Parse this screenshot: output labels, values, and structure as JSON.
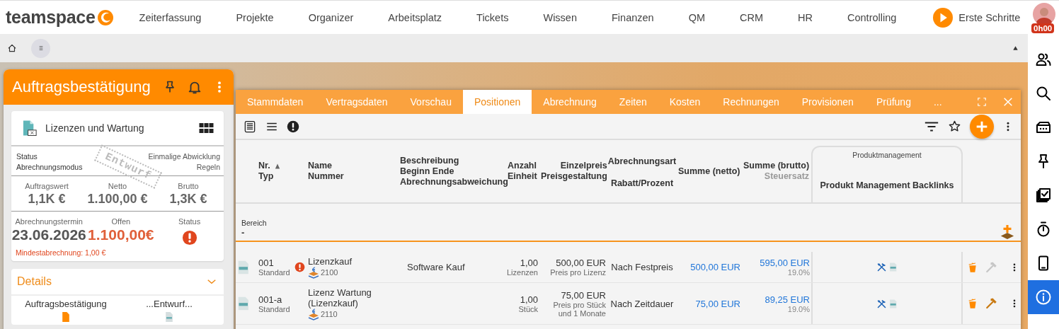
{
  "top_nav": {
    "logo": "teamspace",
    "items": [
      {
        "label": "Zeiterfassung"
      },
      {
        "label": "Projekte"
      },
      {
        "label": "Organizer"
      },
      {
        "label": "Arbeitsplatz"
      },
      {
        "label": "Tickets"
      },
      {
        "label": "Wissen"
      },
      {
        "label": "Finanzen"
      },
      {
        "label": "QM"
      },
      {
        "label": "CRM"
      },
      {
        "label": "HR"
      },
      {
        "label": "Controlling"
      }
    ],
    "getting_started": "Erste Schritte",
    "timer": "0h00"
  },
  "right_sidebar": {
    "items": [
      {
        "kind": "people",
        "selected": false
      },
      {
        "kind": "search",
        "selected": false
      },
      {
        "kind": "ticket",
        "selected": false
      },
      {
        "kind": "pin",
        "selected": false
      },
      {
        "kind": "checklist",
        "selected": false
      },
      {
        "kind": "stopwatch",
        "selected": false
      },
      {
        "kind": "phone",
        "selected": false
      },
      {
        "kind": "info",
        "selected": true
      }
    ]
  },
  "record_card": {
    "title": "Auftragsbestätigung",
    "summary": {
      "name": "Lizenzen und Wartung",
      "stamp": "Entwurf",
      "info": [
        {
          "label": "Status",
          "value": "Einmalige Abwicklung"
        },
        {
          "label": "Abrechnungsmodus",
          "value": "Regeln"
        }
      ],
      "metrics": [
        {
          "label": "Auftragswert",
          "value": "1,1K €",
          "kind": "text"
        },
        {
          "label": "Netto",
          "value": "1.100,00 €",
          "kind": "text"
        },
        {
          "label": "Brutto",
          "value": "1,3K €",
          "kind": "text"
        }
      ],
      "billing": [
        {
          "label": "Abrechnungstermin",
          "value": "23.06.2026",
          "kind": "text"
        },
        {
          "label": "Offen",
          "value": "1.100,00€",
          "kind": "alert-text"
        },
        {
          "label": "Status",
          "kind": "alert-icon"
        }
      ],
      "note": "Mindestabrechnung: 1,00 €"
    },
    "details": {
      "title": "Details",
      "expanded": true,
      "items": [
        {
          "label": "Auftragsbestätigung",
          "kind": "draft-doc"
        },
        {
          "label": "...Entwurf...",
          "kind": "file-doc"
        }
      ]
    }
  },
  "positions_window": {
    "tabs": [
      {
        "label": "Stammdaten",
        "selected": false
      },
      {
        "label": "Vertragsdaten",
        "selected": false
      },
      {
        "label": "Vorschau",
        "selected": false
      },
      {
        "label": "Positionen",
        "selected": true
      },
      {
        "label": "Abrechnung",
        "selected": false
      },
      {
        "label": "Zeiten",
        "selected": false
      },
      {
        "label": "Kosten",
        "selected": false
      },
      {
        "label": "Rechnungen",
        "selected": false
      },
      {
        "label": "Provisionen",
        "selected": false
      },
      {
        "label": "Prüfung",
        "selected": false
      },
      {
        "label": "..."
      }
    ],
    "table": {
      "columns": [
        {
          "lines": [
            "Nr.",
            "Typ"
          ],
          "sorted": true
        },
        {
          "lines": [
            "Name",
            "Nummer"
          ]
        },
        {
          "lines": [
            "Beschreibung",
            "Beginn Ende",
            "Abrechnungsabweichung"
          ]
        },
        {
          "lines": [
            "Anzahl",
            "Einheit"
          ]
        },
        {
          "lines": [
            "Einzelpreis",
            "Preisgestaltung"
          ]
        },
        {
          "lines": [
            "Abrechnungsart",
            "Rabatt/Prozent"
          ]
        },
        {
          "lines": [
            "Summe (netto)"
          ]
        },
        {
          "lines": [
            "Summe (brutto)"
          ],
          "secondary": "Steuersatz"
        }
      ],
      "column_group": {
        "label": "Produktmanagement",
        "columns": [
          {
            "lines": [
              "Produkt Management Backlinks"
            ]
          }
        ]
      },
      "filter": {
        "label": "Bereich",
        "value": "-"
      },
      "rows": [
        {
          "nr": "001",
          "typ": "Standard",
          "warning": true,
          "name": "Lizenzkauf",
          "nummer": "2100",
          "beschreibung": "Software Kauf",
          "anzahl": "1,00",
          "einheit": "Lizenzen",
          "einzelpreis": "500,00 EUR",
          "preisgestaltung": [
            "Preis pro Lizenz"
          ],
          "abrechnungsart": "Nach Festpreis",
          "summe_netto": "500,00 EUR",
          "summe_brutto": "595,00 EUR",
          "steuersatz": "19.0%",
          "tool_enabled": false
        },
        {
          "nr": "001-a",
          "typ": "Standard",
          "warning": false,
          "name": "Lizenz Wartung (Lizenzkauf)",
          "nummer": "2110",
          "anzahl": "1,00",
          "einheit": "Stück",
          "einzelpreis": "75,00 EUR",
          "preisgestaltung": [
            "Preis pro Stück",
            "und 1 Monate"
          ],
          "abrechnungsart": "Nach Zeitdauer",
          "summe_netto": "75,00 EUR",
          "summe_brutto": "89,25 EUR",
          "steuersatz": "19.0%",
          "tool_enabled": true
        }
      ]
    }
  }
}
